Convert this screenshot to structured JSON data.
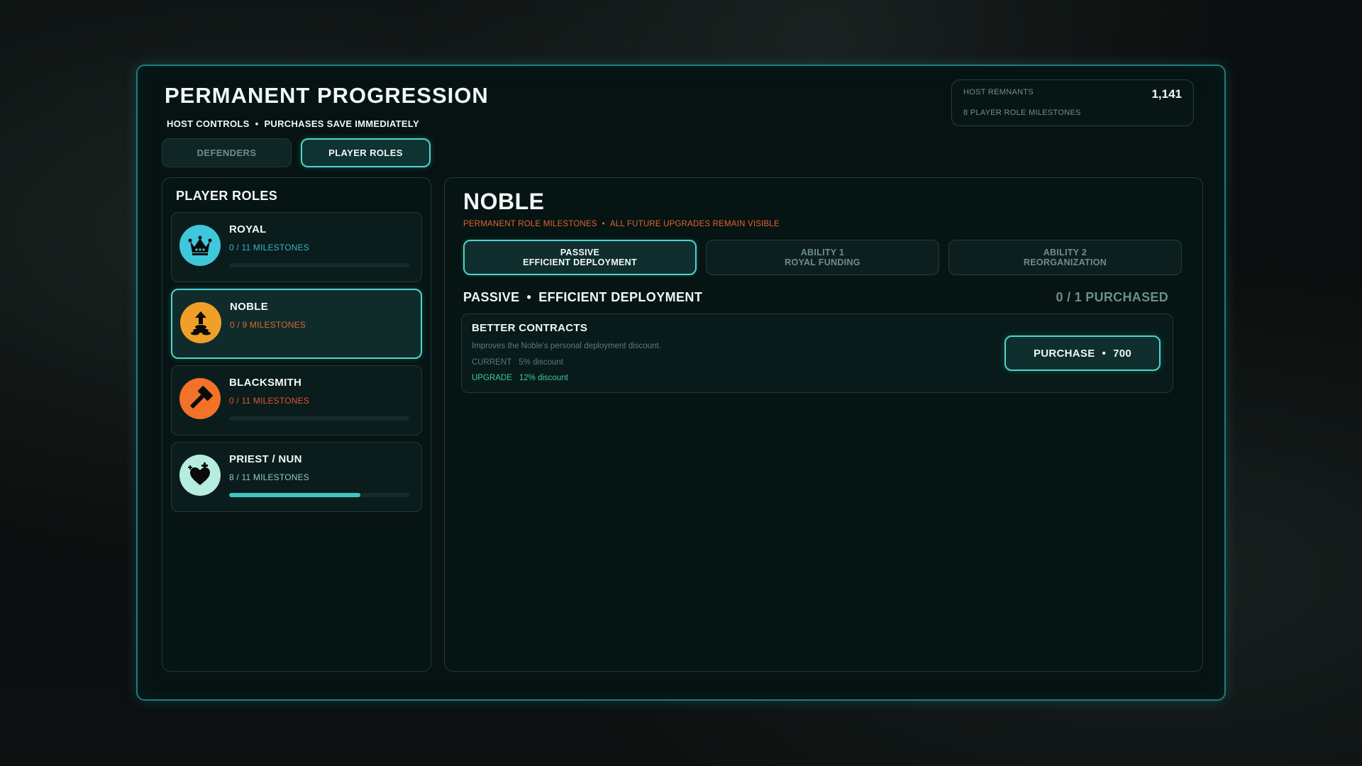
{
  "header": {
    "title": "PERMANENT PROGRESSION",
    "subtitle_left": "HOST CONTROLS",
    "subtitle_right": "PURCHASES SAVE IMMEDIATELY",
    "separator": "•"
  },
  "tabs": [
    {
      "label": "DEFENDERS",
      "active": false
    },
    {
      "label": "PLAYER ROLES",
      "active": true
    }
  ],
  "remnants": {
    "label": "HOST REMNANTS",
    "value": "1,141",
    "sub": "8 PLAYER ROLE MILESTONES"
  },
  "sidebar": {
    "title": "PLAYER ROLES",
    "roles": [
      {
        "name": "ROYAL",
        "milestones": "0 / 11 MILESTONES",
        "progress": 0,
        "icon": "crown-icon",
        "icon_bg": "#3fc7dc",
        "ms_color": "#39b3c9",
        "selected": false
      },
      {
        "name": "NOBLE",
        "milestones": "0 / 9 MILESTONES",
        "progress": 0,
        "icon": "coins-up-icon",
        "icon_bg": "#f0a028",
        "ms_color": "#e0642d",
        "selected": true
      },
      {
        "name": "BLACKSMITH",
        "milestones": "0 / 11 MILESTONES",
        "progress": 0,
        "icon": "hammer-icon",
        "icon_bg": "#f27228",
        "ms_color": "#e0552b",
        "selected": false
      },
      {
        "name": "PRIEST / NUN",
        "milestones": "8 / 11 MILESTONES",
        "progress": 0.727,
        "icon": "healing-heart-icon",
        "icon_bg": "#b7ece0",
        "ms_color": "#8ec9c3",
        "selected": false
      }
    ]
  },
  "detail": {
    "title": "NOBLE",
    "sub_left": "PERMANENT ROLE MILESTONES",
    "sub_right": "ALL FUTURE UPGRADES REMAIN VISIBLE",
    "ability_tabs": [
      {
        "line1": "PASSIVE",
        "line2": "EFFICIENT DEPLOYMENT",
        "active": true
      },
      {
        "line1": "ABILITY 1",
        "line2": "ROYAL FUNDING",
        "active": false
      },
      {
        "line1": "ABILITY 2",
        "line2": "REORGANIZATION",
        "active": false
      }
    ],
    "section_kind": "PASSIVE",
    "section_name": "EFFICIENT DEPLOYMENT",
    "purchased": "0 / 1 PURCHASED",
    "upgrade": {
      "name": "BETTER CONTRACTS",
      "description": "Improves the Noble's personal deployment discount.",
      "current_label": "CURRENT",
      "current_value": "5% discount",
      "upgrade_label": "UPGRADE",
      "upgrade_value": "12% discount",
      "button_label": "PURCHASE",
      "button_cost": "700"
    }
  },
  "colors": {
    "accent": "#4fd4cc",
    "warning": "#e0642d",
    "upgrade_green": "#3fc9a0"
  }
}
